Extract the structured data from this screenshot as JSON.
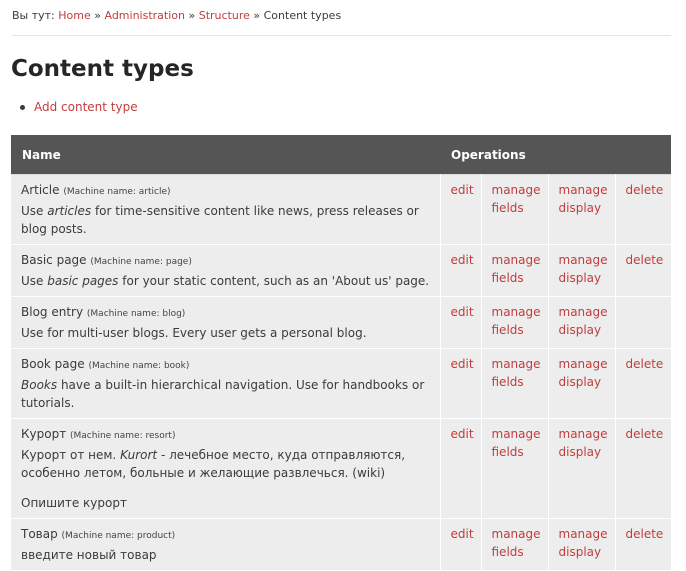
{
  "breadcrumb": {
    "prefix": "Вы тут:",
    "items": [
      "Home",
      "Administration",
      "Structure"
    ],
    "current": "Content types",
    "separator": "»"
  },
  "page_title": "Content types",
  "actions": [
    "Add content type"
  ],
  "table": {
    "headers": {
      "name": "Name",
      "operations": "Operations"
    },
    "ops": {
      "edit": "edit",
      "manage_fields": "manage fields",
      "manage_display": "manage display",
      "delete": "delete"
    },
    "rows": [
      {
        "name": "Article",
        "machine": "(Machine name: article)",
        "desc_html": "Use <em>articles</em> for time-sensitive content like news, press releases or blog posts.",
        "extra": "",
        "has_delete": true
      },
      {
        "name": "Basic page",
        "machine": "(Machine name: page)",
        "desc_html": "Use <em>basic pages</em> for your static content, such as an 'About us' page.",
        "extra": "",
        "has_delete": true
      },
      {
        "name": "Blog entry",
        "machine": "(Machine name: blog)",
        "desc_html": "Use for multi-user blogs. Every user gets a personal blog.",
        "extra": "",
        "has_delete": false
      },
      {
        "name": "Book page",
        "machine": "(Machine name: book)",
        "desc_html": "<em>Books</em> have a built-in hierarchical navigation. Use for handbooks or tutorials.",
        "extra": "",
        "has_delete": true
      },
      {
        "name": "Курорт",
        "machine": "(Machine name: resort)",
        "desc_html": "Курорт от нем. <em>Kurort</em> - лечебное место, куда отправляются, особенно летом, больные и желающие развлечься. (wiki)",
        "extra": "Опишите курорт",
        "has_delete": true
      },
      {
        "name": "Товар",
        "machine": "(Machine name: product)",
        "desc_html": "введите новый товар",
        "extra": "",
        "has_delete": true
      }
    ]
  }
}
